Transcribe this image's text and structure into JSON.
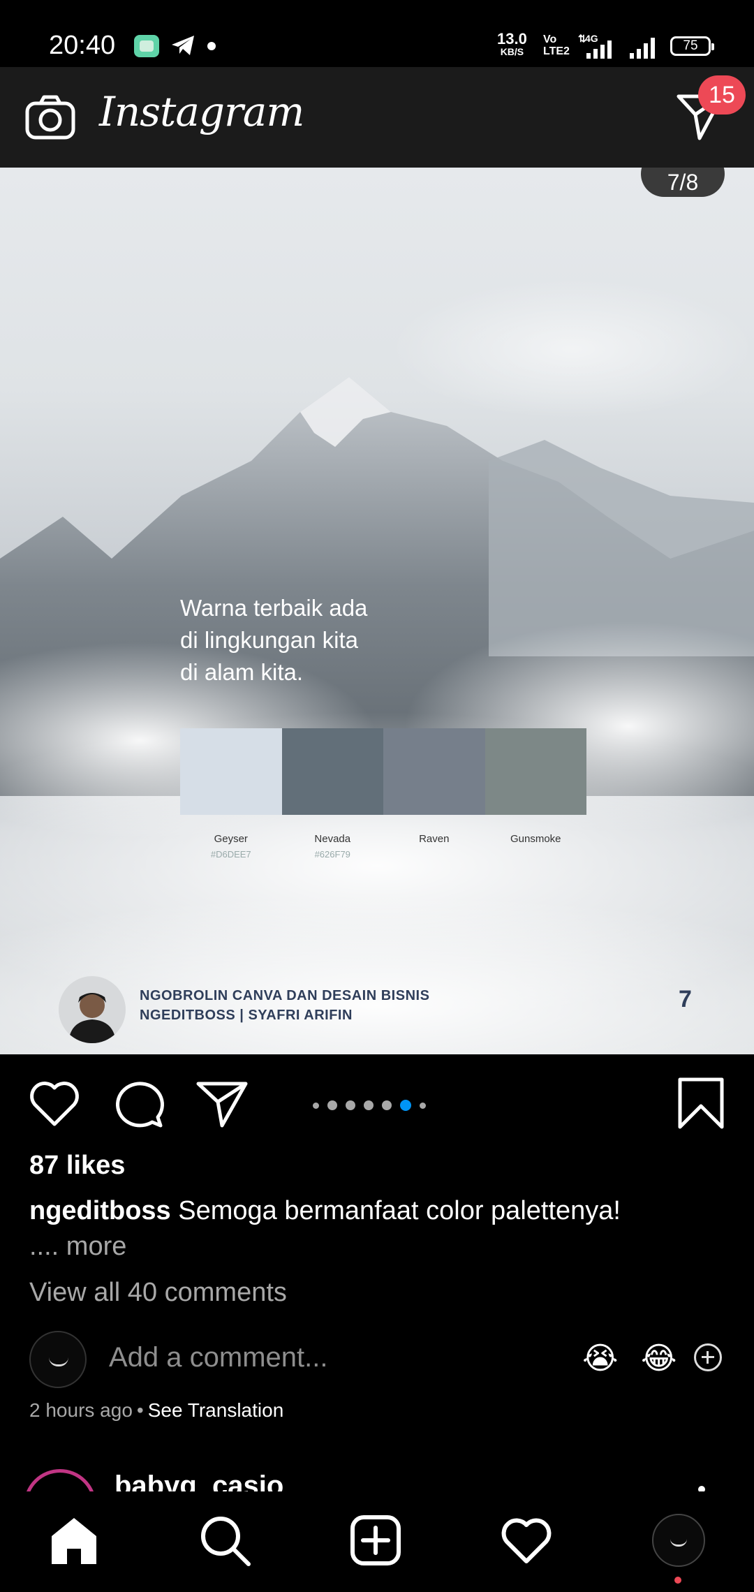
{
  "status_bar": {
    "time": "20:40",
    "net_speed_value": "13.0",
    "net_speed_unit": "KB/S",
    "volte_top": "Vo",
    "volte_bottom": "LTE2",
    "signal_label": "4G",
    "battery": "75"
  },
  "header": {
    "logo_text": "Instagram",
    "dm_badge": "15"
  },
  "post": {
    "page_indicator": "7/8",
    "image_text": {
      "quote_line1": "Warna terbaik ada",
      "quote_line2": "di lingkungan kita",
      "quote_line3": "di alam kita.",
      "palette": [
        {
          "name": "Geyser",
          "hex": "#D6DEE7",
          "color": "#d6dee7"
        },
        {
          "name": "Nevada",
          "hex": "#626F79",
          "color": "#626f79"
        },
        {
          "name": "Raven",
          "hex": "",
          "color": "#767f8b"
        },
        {
          "name": "Gunsmoke",
          "hex": "",
          "color": "#7d8887"
        }
      ],
      "credit_line1": "NGOBROLIN CANVA DAN DESAIN BISNIS",
      "credit_line2": "NGEDITBOSS | SYAFRI ARIFIN",
      "slide_number": "7"
    },
    "carousel": {
      "total": 7,
      "active_index": 5
    },
    "likes": "87 likes",
    "caption_user": "ngeditboss",
    "caption_text": "Semoga bermanfaat color palettenya!",
    "caption_more_prefix": "....",
    "caption_more": "more",
    "view_comments": "View all 40 comments",
    "comment_placeholder": "Add a comment...",
    "emoji_1": "😭",
    "emoji_2": "😂",
    "time_ago": "2 hours ago",
    "separator": "•",
    "see_translation": "See Translation"
  },
  "next_post": {
    "username": "babyg_casio"
  },
  "colors": {
    "badge": "#ed4956",
    "carousel_active": "#0095f6",
    "muted_text": "#a8a8a8"
  }
}
